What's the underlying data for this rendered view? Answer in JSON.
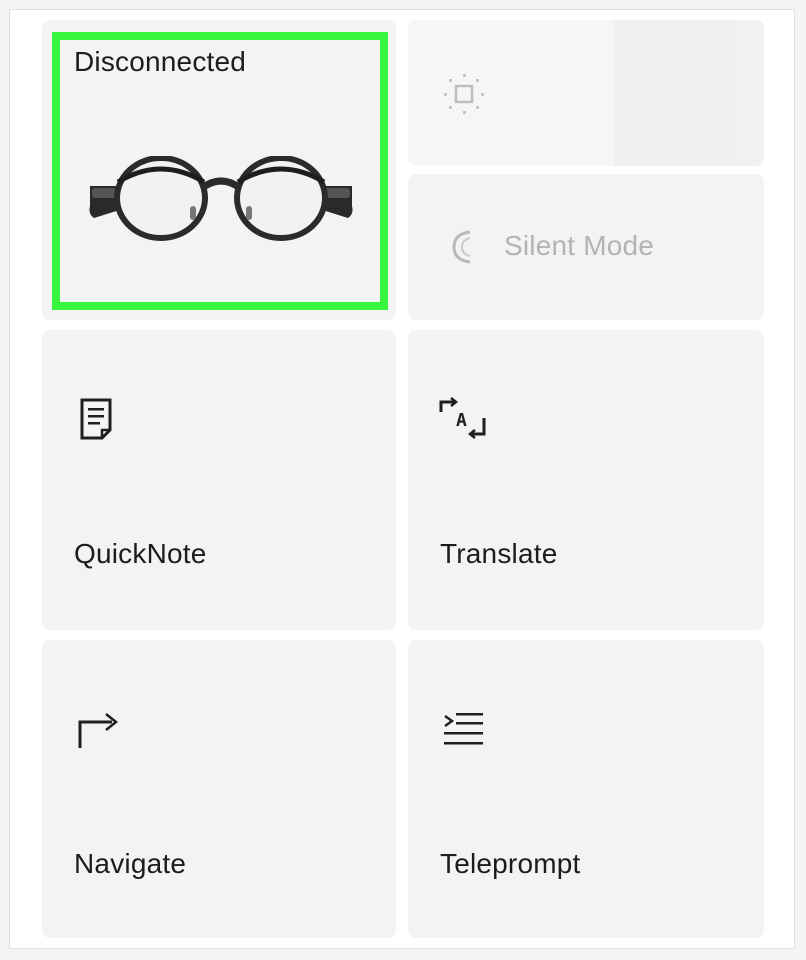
{
  "device": {
    "status": "Disconnected",
    "image": "smart-glasses"
  },
  "controls": {
    "brightness_icon": "brightness-icon",
    "silent_mode_label": "Silent Mode",
    "silent_mode_icon": "moon-icon"
  },
  "features": [
    {
      "label": "QuickNote",
      "icon": "note-icon"
    },
    {
      "label": "Translate",
      "icon": "translate-icon"
    },
    {
      "label": "Navigate",
      "icon": "navigate-arrow-icon"
    },
    {
      "label": "Teleprompt",
      "icon": "teleprompt-icon"
    }
  ],
  "colors": {
    "tile_background": "#f3f3f3",
    "highlight": "#39f53d",
    "text_primary": "#1c1c1c",
    "text_disabled": "#b3b3b3"
  }
}
